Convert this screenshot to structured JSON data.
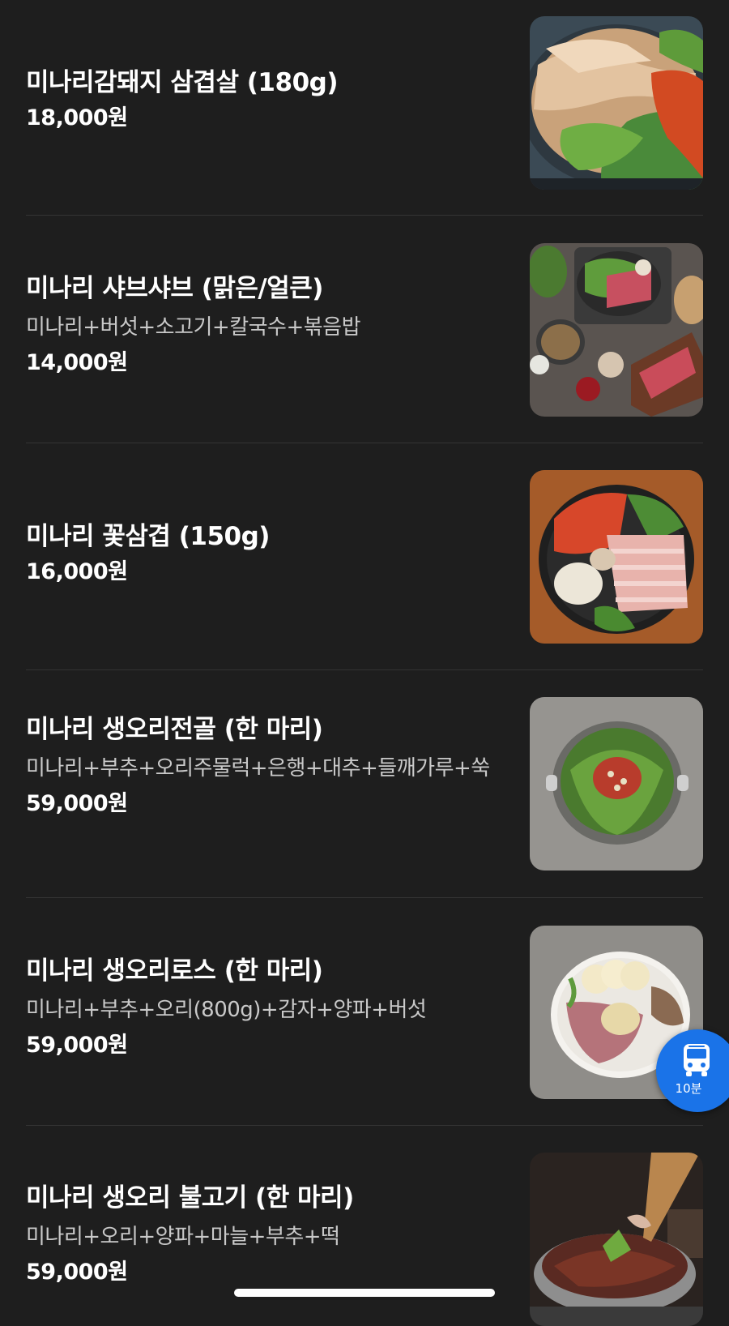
{
  "menu": {
    "items": [
      {
        "name": "미나리감돼지 삼겹살 (180g)",
        "desc": "",
        "price": "18,000원",
        "image_icon": "pork-belly-grill-photo"
      },
      {
        "name": "미나리 샤브샤브 (맑은/얼큰)",
        "desc": "미나리+버섯+소고기+칼국수+볶음밥",
        "price": "14,000원",
        "image_icon": "shabu-shabu-photo"
      },
      {
        "name": "미나리 꽃삼겹 (150g)",
        "desc": "",
        "price": "16,000원",
        "image_icon": "flower-pork-belly-photo"
      },
      {
        "name": "미나리 생오리전골 (한 마리)",
        "desc": "미나리+부추+오리주물럭+은행+대추+들깨가루+쑥",
        "price": "59,000원",
        "image_icon": "duck-hotpot-photo"
      },
      {
        "name": "미나리 생오리로스 (한 마리)",
        "desc": "미나리+부추+오리(800g)+감자+양파+버섯",
        "price": "59,000원",
        "image_icon": "duck-roast-photo"
      },
      {
        "name": "미나리 생오리 불고기 (한 마리)",
        "desc": "미나리+오리+양파+마늘+부추+떡",
        "price": "59,000원",
        "image_icon": "duck-bulgogi-photo"
      }
    ]
  },
  "transit": {
    "time": "10분",
    "icon": "bus-icon"
  },
  "colors": {
    "background": "#1e1e1e",
    "divider": "#343434",
    "accent": "#1a73e8",
    "desc_text": "#c9c9c9"
  }
}
